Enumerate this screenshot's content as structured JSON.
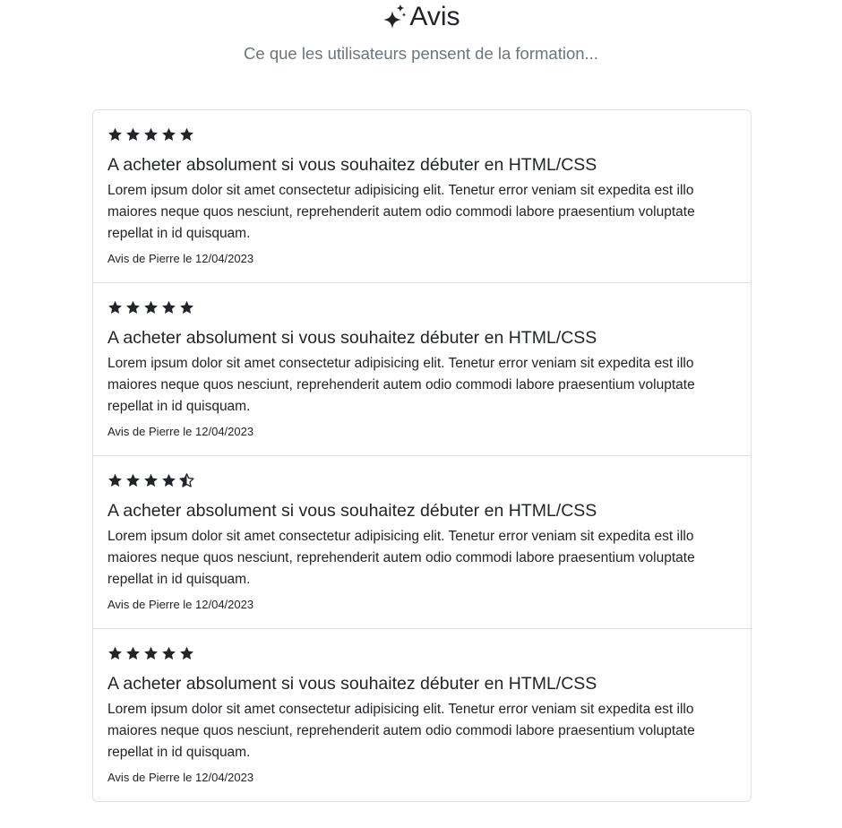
{
  "header": {
    "icon": "sparkles-icon",
    "title": "Avis",
    "subtitle": "Ce que les utilisateurs pensent de la formation..."
  },
  "reviews": [
    {
      "rating": 5,
      "title": "A acheter absolument si vous souhaitez débuter en HTML/CSS",
      "body": "Lorem ipsum dolor sit amet consectetur adipisicing elit. Tenetur error veniam sit expedita est illo maiores neque quos nesciunt, reprehenderit autem odio commodi labore praesentium voluptate repellat in id quisquam.",
      "meta": "Avis de Pierre le 12/04/2023"
    },
    {
      "rating": 5,
      "title": "A acheter absolument si vous souhaitez débuter en HTML/CSS",
      "body": "Lorem ipsum dolor sit amet consectetur adipisicing elit. Tenetur error veniam sit expedita est illo maiores neque quos nesciunt, reprehenderit autem odio commodi labore praesentium voluptate repellat in id quisquam.",
      "meta": "Avis de Pierre le 12/04/2023"
    },
    {
      "rating": 4.5,
      "title": "A acheter absolument si vous souhaitez débuter en HTML/CSS",
      "body": "Lorem ipsum dolor sit amet consectetur adipisicing elit. Tenetur error veniam sit expedita est illo maiores neque quos nesciunt, reprehenderit autem odio commodi labore praesentium voluptate repellat in id quisquam.",
      "meta": "Avis de Pierre le 12/04/2023"
    },
    {
      "rating": 5,
      "title": "A acheter absolument si vous souhaitez débuter en HTML/CSS",
      "body": "Lorem ipsum dolor sit amet consectetur adipisicing elit. Tenetur error veniam sit expedita est illo maiores neque quos nesciunt, reprehenderit autem odio commodi labore praesentium voluptate repellat in id quisquam.",
      "meta": "Avis de Pierre le 12/04/2023"
    }
  ],
  "colors": {
    "text": "#212529",
    "muted": "#6c757d",
    "border": "#dee2e6"
  }
}
